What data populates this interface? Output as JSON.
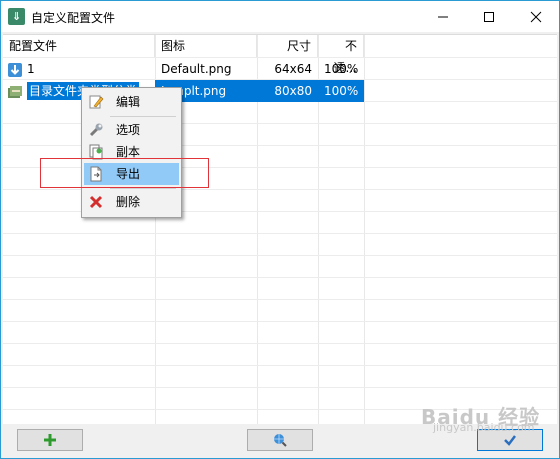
{
  "window": {
    "title": "自定义配置文件"
  },
  "columns": [
    "配置文件",
    "图标",
    "尺寸",
    "不透..."
  ],
  "rows": [
    {
      "name": "1",
      "icon": "Default.png",
      "size": "64x64",
      "opacity": "100%"
    },
    {
      "name": "目录文件夹类型分类",
      "icon": "Jumplt.png",
      "size": "80x80",
      "opacity": "100%"
    }
  ],
  "context_menu": {
    "edit": "编辑",
    "options": "选项",
    "copy": "副本",
    "export": "导出",
    "delete": "删除"
  },
  "watermark": {
    "text": "Baidu 经验",
    "sub": "jingyan.baidu.com"
  },
  "colors": {
    "selection": "#0078d7",
    "menu_highlight": "#91c9f7",
    "annotation": "#e0343a"
  }
}
